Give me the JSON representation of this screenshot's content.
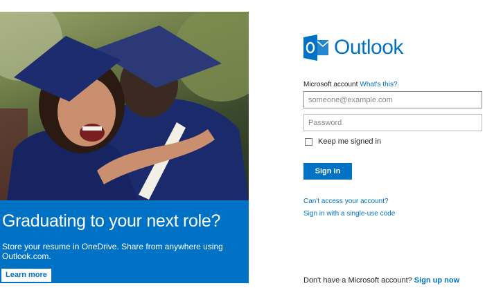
{
  "promo": {
    "image_alt": "Graduates in caps and gowns hugging",
    "headline": "Graduating to your next role?",
    "body": "Store your resume in OneDrive. Share from anywhere using Outlook.com.",
    "learn_more_label": "Learn more"
  },
  "logo": {
    "text": "Outlook",
    "icon": "outlook-logo-icon"
  },
  "form": {
    "account_label": "Microsoft account",
    "whats_this_link": "What's this?",
    "email_placeholder": "someone@example.com",
    "password_placeholder": "Password",
    "keep_signed_in_label": "Keep me signed in",
    "keep_signed_in_checked": false,
    "sign_in_label": "Sign in"
  },
  "links": {
    "cant_access": "Can't access your account?",
    "single_use": "Sign in with a single-use code"
  },
  "footer": {
    "no_account_text": "Don't have a Microsoft account?",
    "sign_up_link": "Sign up now"
  },
  "colors": {
    "accent": "#0072c6",
    "text": "#222222",
    "border": "#bababa"
  }
}
